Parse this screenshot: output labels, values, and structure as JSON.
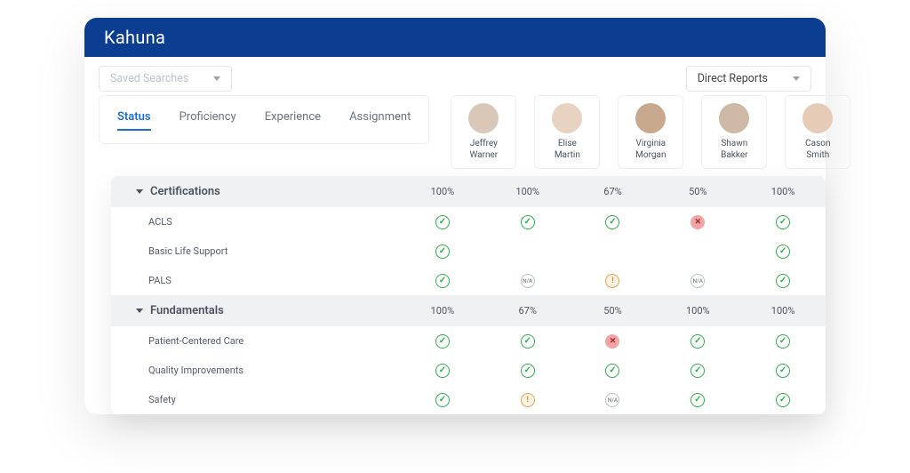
{
  "brand": "Kahuna",
  "toolbar": {
    "savedSearches": "Saved Searches",
    "directReports": "Direct Reports"
  },
  "tabs": [
    {
      "label": "Status",
      "active": true
    },
    {
      "label": "Proficiency",
      "active": false
    },
    {
      "label": "Experience",
      "active": false
    },
    {
      "label": "Assignment",
      "active": false
    }
  ],
  "people": [
    {
      "first": "Jeffrey",
      "last": "Warner",
      "bg": "#d9c7b8"
    },
    {
      "first": "Elise",
      "last": "Martin",
      "bg": "#e8d2c2"
    },
    {
      "first": "Virginia",
      "last": "Morgan",
      "bg": "#c9a98d"
    },
    {
      "first": "Shawn",
      "last": "Bakker",
      "bg": "#cdb9a5"
    },
    {
      "first": "Cason",
      "last": "Smith",
      "bg": "#e6cbb7"
    }
  ],
  "groups": [
    {
      "title": "Certifications",
      "summary": [
        "100%",
        "100%",
        "67%",
        "50%",
        "100%"
      ],
      "rows": [
        {
          "name": "ACLS",
          "cells": [
            "check",
            "check",
            "check",
            "fail",
            "check"
          ]
        },
        {
          "name": "Basic Life Support",
          "cells": [
            "check",
            "",
            "",
            "",
            "check"
          ]
        },
        {
          "name": "PALS",
          "cells": [
            "check",
            "na",
            "warn",
            "na",
            "check"
          ]
        }
      ]
    },
    {
      "title": "Fundamentals",
      "summary": [
        "100%",
        "67%",
        "50%",
        "100%",
        "100%"
      ],
      "rows": [
        {
          "name": "Patient-Centered Care",
          "cells": [
            "check",
            "check",
            "fail",
            "check",
            "check"
          ]
        },
        {
          "name": "Quality Improvements",
          "cells": [
            "check",
            "check",
            "check",
            "check",
            "check"
          ]
        },
        {
          "name": "Safety",
          "cells": [
            "check",
            "warn",
            "na",
            "check",
            "check"
          ]
        }
      ]
    }
  ]
}
